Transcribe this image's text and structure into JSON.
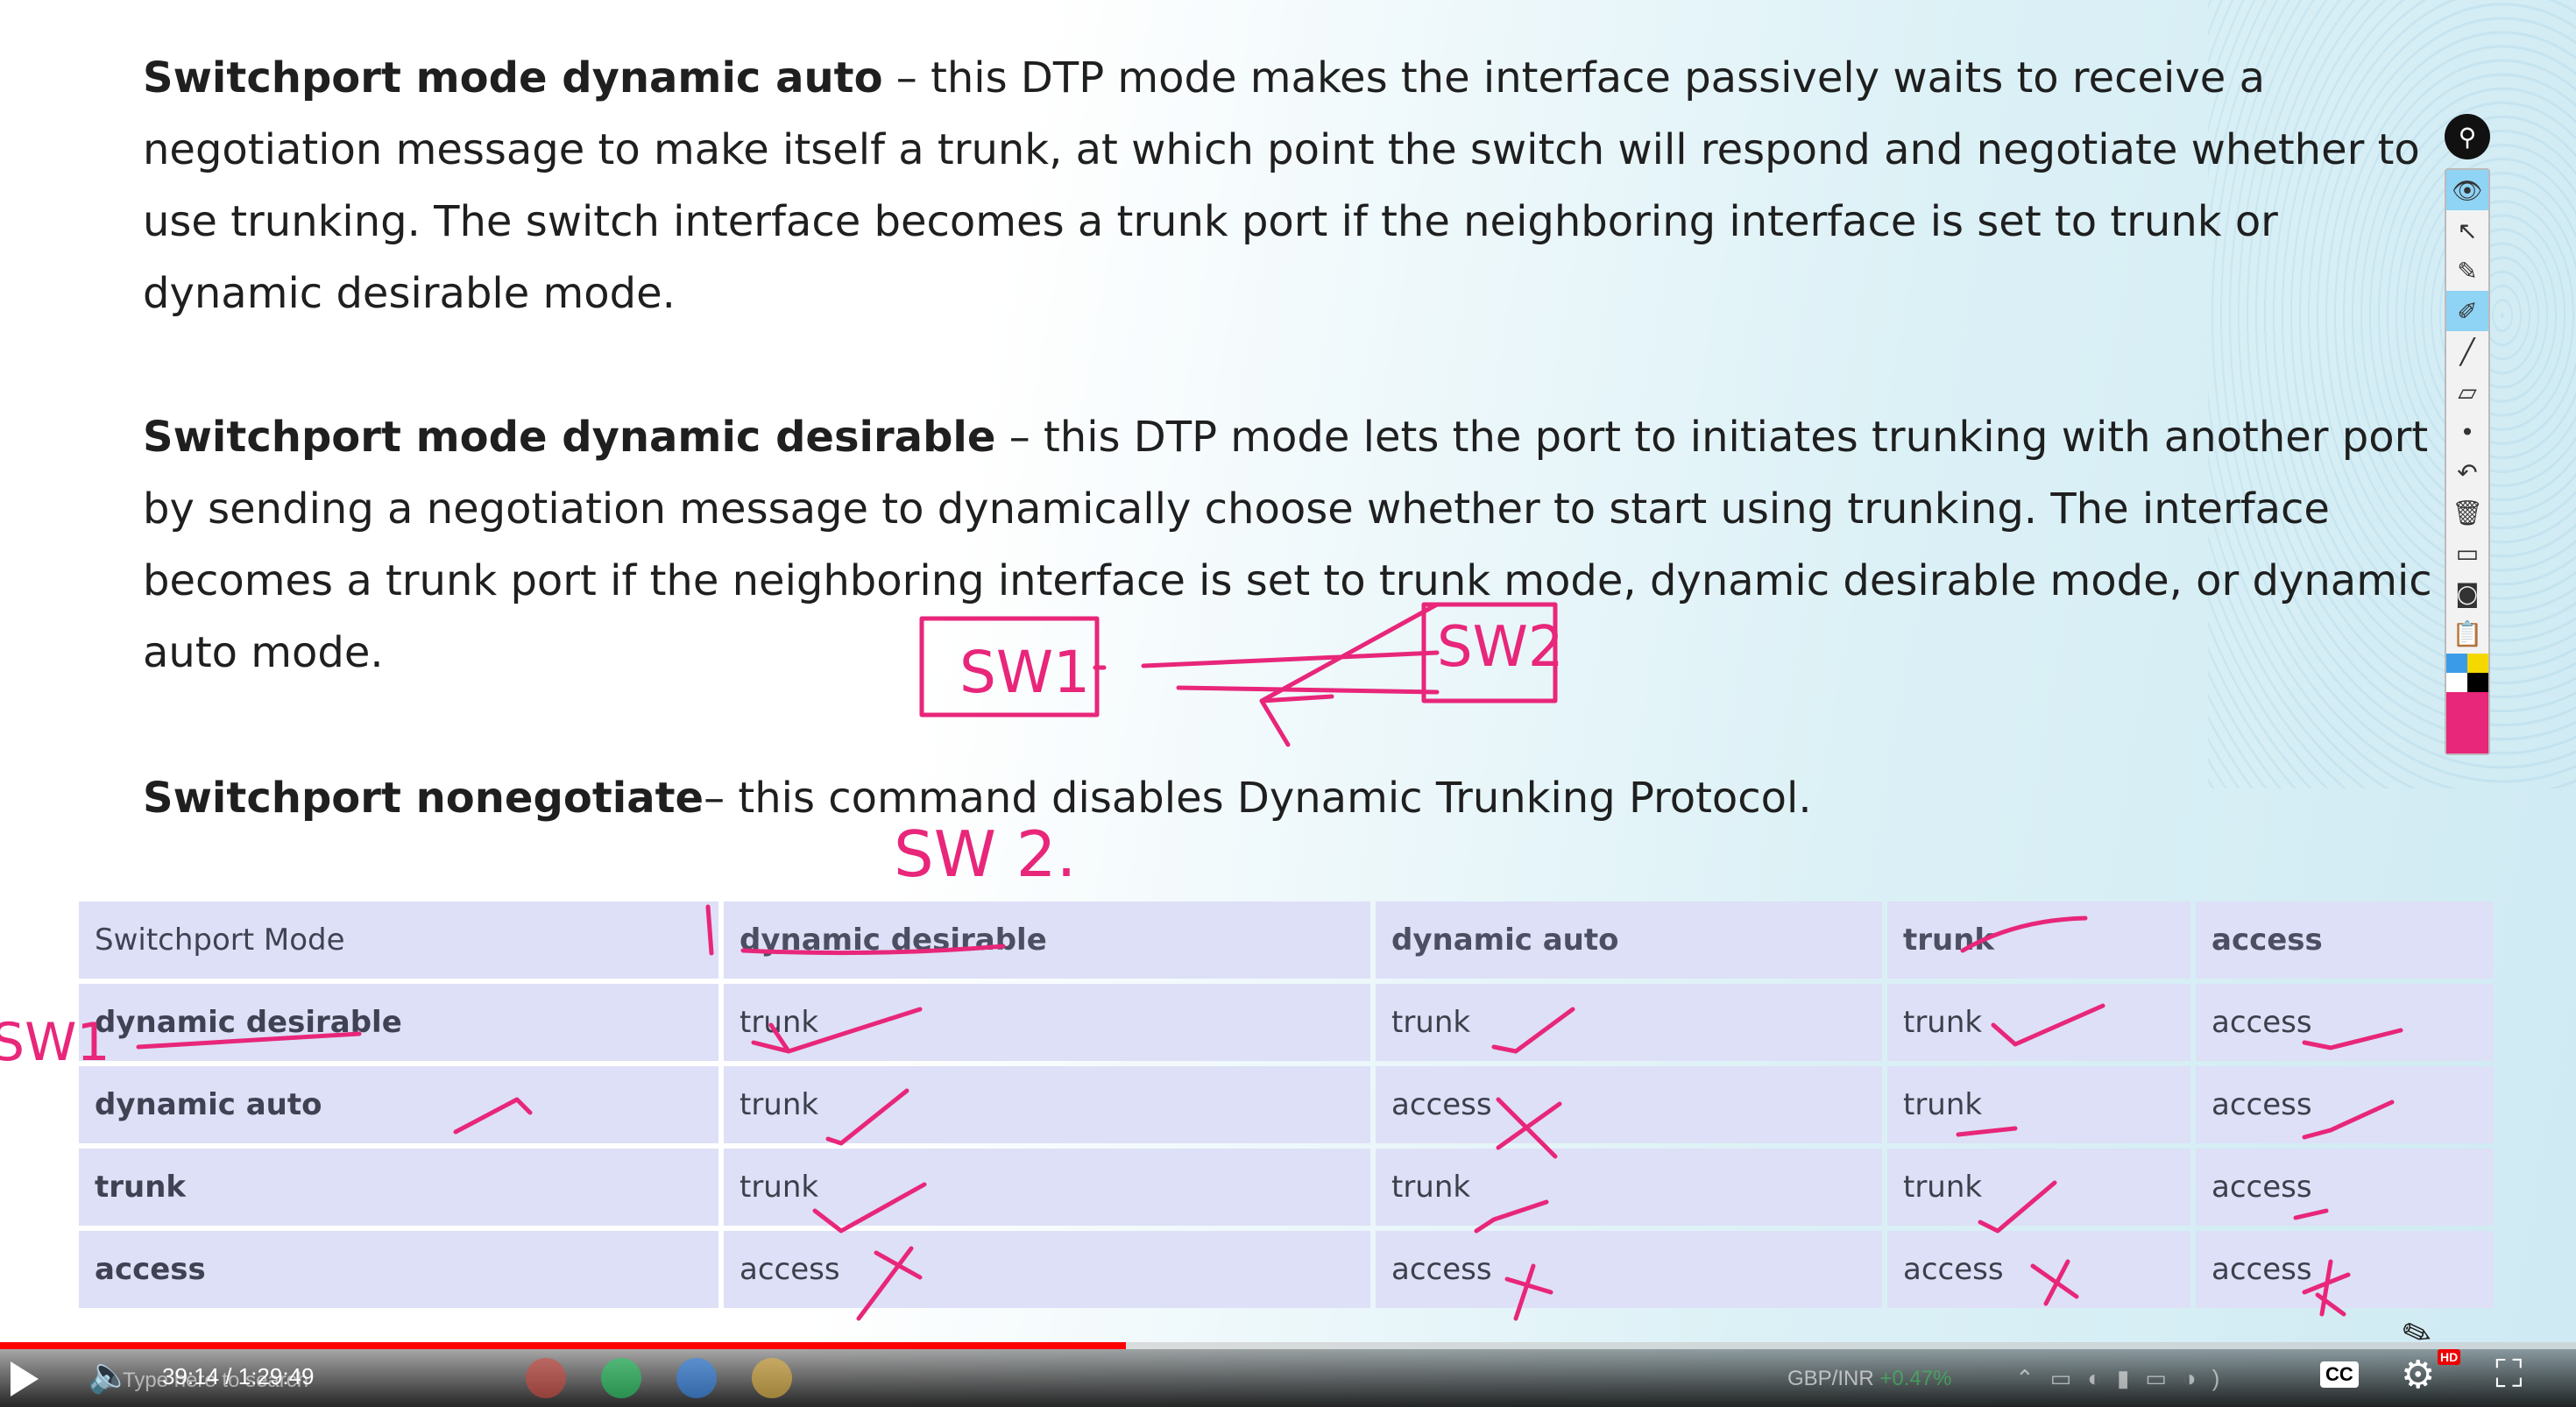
{
  "document": {
    "p1_bold": "Switchport mode dynamic auto",
    "p1_text": " – this DTP mode makes the interface passively waits to receive a negotiation message to make itself a trunk, at which point the switch will respond and negotiate whether to use trunking. The switch interface becomes a trunk port if the neighboring interface is set to trunk or dynamic desirable mode.",
    "p2_bold": "Switchport mode dynamic desirable",
    "p2_text": " – this DTP mode lets the port to initiates trunking with another port by sending a negotiation message to dynamically choose whether to start using trunking. The interface becomes a trunk port if the neighboring interface is set to trunk mode, dynamic desirable mode, or dynamic auto mode.",
    "p3_bold": "Switchport nonegotiate",
    "p3_text": "– this command disables Dynamic Trunking Protocol."
  },
  "table": {
    "header": [
      "Switchport Mode",
      "dynamic desirable",
      "dynamic auto",
      "trunk",
      "access"
    ],
    "rows": [
      [
        "dynamic desirable",
        "trunk",
        "trunk",
        "trunk",
        "access"
      ],
      [
        "dynamic auto",
        "trunk",
        "access",
        "trunk",
        "access"
      ],
      [
        "trunk",
        "trunk",
        "trunk",
        "trunk",
        "access"
      ],
      [
        "access",
        "access",
        "access",
        "access",
        "access"
      ]
    ]
  },
  "annotations": {
    "box1": "SW1",
    "box2": "SW2",
    "below": "SW 2.",
    "side": "SW1"
  },
  "toolbar": {
    "tools": [
      "pin-icon",
      "eye-icon",
      "pointer-icon",
      "pen-off-icon",
      "highlighter-icon",
      "line-icon",
      "eraser-icon",
      "dot-icon",
      "undo-icon",
      "trash-icon",
      "screen-icon",
      "camera-icon",
      "clipboard-icon"
    ],
    "colors": [
      "#3a9be8",
      "#f5d800",
      "#ffffff",
      "#000000"
    ],
    "active_color": "#e8267a"
  },
  "player": {
    "time": "39:14 / 1:29:49",
    "progress": 0.437,
    "cc_label": "CC",
    "hd_badge": "HD",
    "search_placeholder": "Type here to search",
    "ticker": "GBP/INR",
    "ticker_change": "+0.47%"
  }
}
